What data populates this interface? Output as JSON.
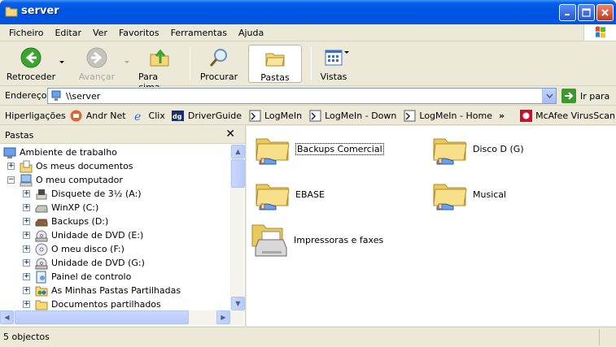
{
  "window": {
    "title": "server",
    "minimize": "minimize",
    "maximize": "maximize",
    "close": "close"
  },
  "menu": [
    "Ficheiro",
    "Editar",
    "Ver",
    "Favoritos",
    "Ferramentas",
    "Ajuda"
  ],
  "toolbar": {
    "back": "Retroceder",
    "forward": "Avançar",
    "up": "Para cima",
    "search": "Procurar",
    "folders": "Pastas",
    "views": "Vistas"
  },
  "address": {
    "label": "Endereço",
    "value": "\\\\server",
    "go": "Ir para"
  },
  "links": {
    "label": "Hiperligações",
    "items": [
      "Andr Net",
      "Clix",
      "DriverGuide",
      "LogMeIn",
      "LogMeIn - Down",
      "LogMeIn - Home",
      "McAfee VirusScan"
    ]
  },
  "folders_pane": {
    "title": "Pastas",
    "tree": [
      {
        "label": "Ambiente de trabalho",
        "icon": "desktop-icon"
      },
      {
        "label": "Os meus documentos",
        "icon": "my-documents-icon"
      },
      {
        "label": "O meu computador",
        "icon": "my-computer-icon"
      },
      {
        "label": "Disquete de 3½ (A:)",
        "icon": "floppy-icon"
      },
      {
        "label": "WinXP (C:)",
        "icon": "hard-drive-icon"
      },
      {
        "label": "Backups (D:)",
        "icon": "hard-drive-icon"
      },
      {
        "label": "Unidade de DVD (E:)",
        "icon": "dvd-drive-icon"
      },
      {
        "label": "O meu disco (F:)",
        "icon": "cd-icon"
      },
      {
        "label": "Unidade de DVD (G:)",
        "icon": "dvd-drive-icon"
      },
      {
        "label": "Painel de controlo",
        "icon": "control-panel-icon"
      },
      {
        "label": "As Minhas Pastas Partilhadas",
        "icon": "shared-folders-icon"
      },
      {
        "label": "Documentos partilhados",
        "icon": "folder-icon"
      }
    ]
  },
  "content": {
    "items": [
      {
        "label": "Backups Comercial",
        "icon": "shared-folder-icon"
      },
      {
        "label": "Disco D (G)",
        "icon": "shared-folder-icon"
      },
      {
        "label": "EBASE",
        "icon": "shared-folder-icon"
      },
      {
        "label": "Musical",
        "icon": "shared-folder-icon"
      },
      {
        "label": "Impressoras e faxes",
        "icon": "printers-faxes-icon"
      }
    ]
  },
  "status": {
    "text": "5 objectos"
  }
}
